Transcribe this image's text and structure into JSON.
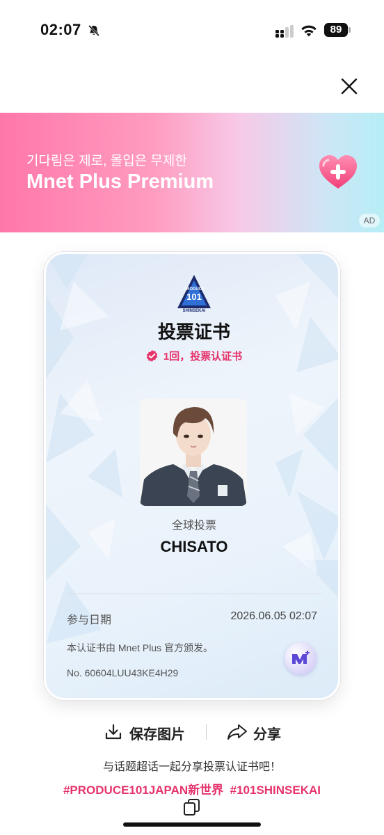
{
  "status_bar": {
    "time": "02:07",
    "battery": "89",
    "icons": [
      "bell-slash-icon",
      "signal-icon",
      "wifi-icon",
      "battery-icon"
    ]
  },
  "close_icon": "close-icon",
  "ad": {
    "subtitle": "기다림은 제로, 몰입은 무제한",
    "title": "Mnet Plus Premium",
    "tag": "AD",
    "icon": "heart-plus-icon",
    "colors": {
      "start": "#ff77a9",
      "end": "#b6eef6"
    }
  },
  "certificate": {
    "logo": "produce101-shinsekai-logo",
    "title": "投票证书",
    "badge_text": "1回，投票认证书",
    "vote_type": "全球投票",
    "name": "CHISATO",
    "date_label": "参与日期",
    "date_value": "2026.06.05 02:07",
    "issuer_text": "本认证书由 Mnet Plus 官方颁发。",
    "serial": "No. 60604LUU43KE4H29",
    "accent_color": "#e6336b"
  },
  "actions": {
    "save_label": "保存图片",
    "share_label": "分享"
  },
  "share_hint": "与话题超话一起分享投票认证书吧！",
  "hashtags": [
    "#PRODUCE101JAPAN新世界",
    "#101SHINSEKAI"
  ]
}
